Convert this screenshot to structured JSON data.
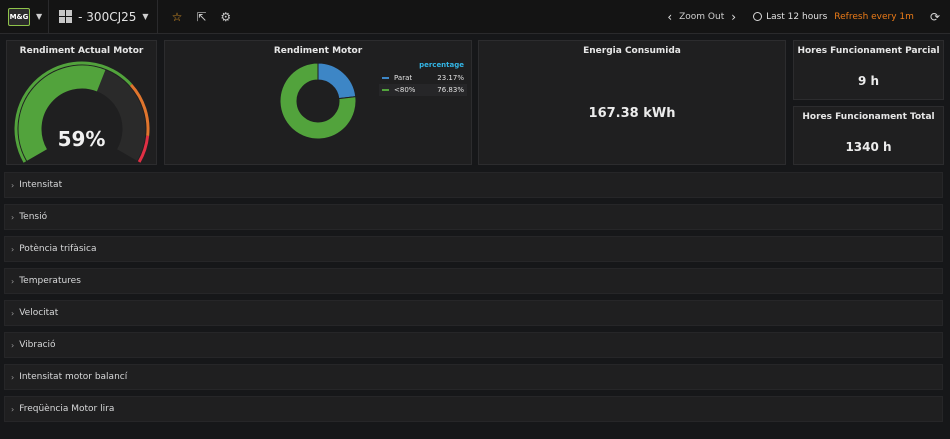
{
  "navbar": {
    "logo_text": "M&G",
    "dashboard_title": "- 300CJ25",
    "zoom_label": "Zoom Out",
    "time_range": "Last 12 hours",
    "refresh_label": "Refresh every 1m"
  },
  "panels": {
    "gauge": {
      "title": "Rendiment Actual Motor",
      "value_text": "59%",
      "value": 59,
      "max": 100,
      "colors": {
        "value": "#52a33c",
        "track": "#2a2a2a",
        "threshold_low": "#52a33c",
        "threshold_mid": "#e0752d",
        "threshold_high": "#e02f44"
      }
    },
    "pie": {
      "title": "Rendiment Motor",
      "legend_header": "percentage",
      "items": [
        {
          "name": "Parat",
          "value_text": "23.17%",
          "value": 23.17,
          "color": "#3d86c6"
        },
        {
          "name": "<80%",
          "value_text": "76.83%",
          "value": 76.83,
          "color": "#52a33c"
        }
      ]
    },
    "energia": {
      "title": "Energia Consumida",
      "value": "167.38 kWh"
    },
    "hores_parcial": {
      "title": "Hores Funcionament Parcial",
      "value": "9 h"
    },
    "hores_total": {
      "title": "Hores Funcionament Total",
      "value": "1340 h"
    }
  },
  "rows": [
    {
      "title": "Intensitat"
    },
    {
      "title": "Tensió"
    },
    {
      "title": "Potència trifàsica"
    },
    {
      "title": "Temperatures"
    },
    {
      "title": "Velocitat"
    },
    {
      "title": "Vibració"
    },
    {
      "title": "Intensitat motor balancí"
    },
    {
      "title": "Freqüència Motor lira"
    }
  ]
}
